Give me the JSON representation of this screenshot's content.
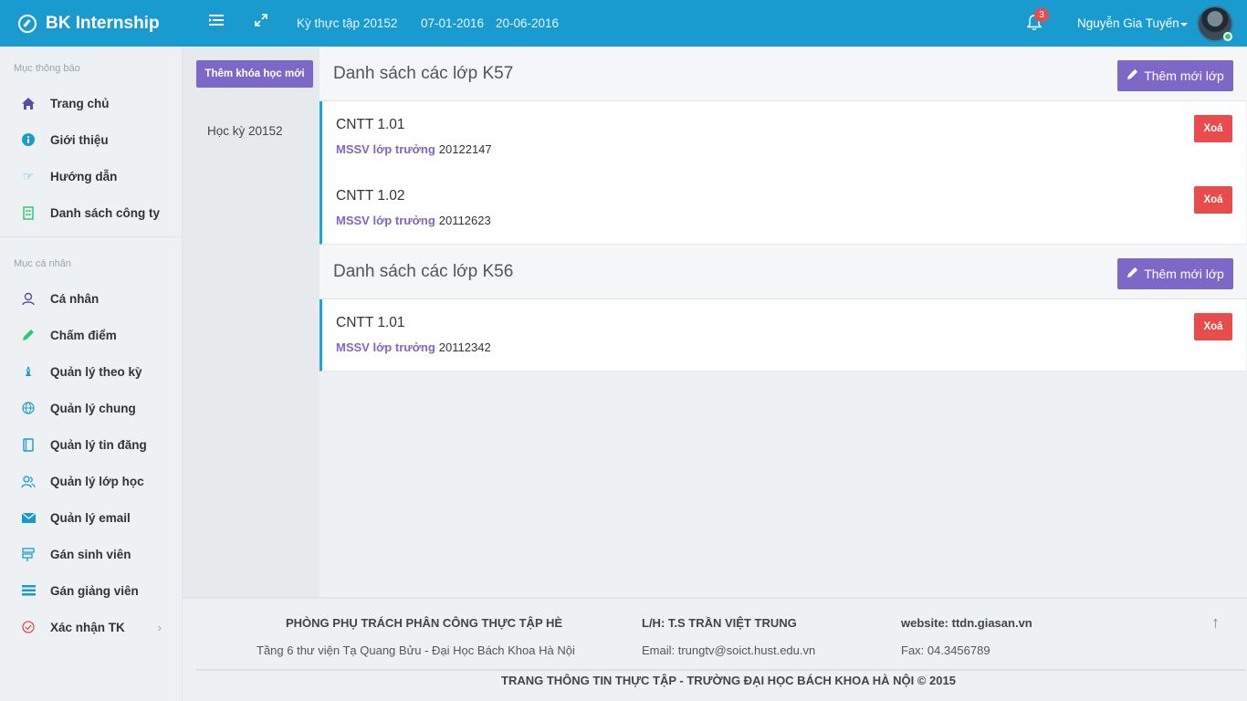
{
  "header": {
    "brand": "BK Internship",
    "term": "Kỳ thực tập 20152",
    "start_date": "07-01-2016",
    "end_date": "20-06-2016",
    "notification_count": "3",
    "user_name": "Nguyễn Gia Tuyến"
  },
  "sidebar": {
    "section1_title": "Mục thông báo",
    "section1_items": [
      {
        "label": "Trang chủ",
        "icon": "home-icon",
        "color": "#5b4aa8"
      },
      {
        "label": "Giới thiệu",
        "icon": "info-icon",
        "color": "#1a9bd0"
      },
      {
        "label": "Hướng dẫn",
        "icon": "hand-point-icon",
        "color": "#4fb7e0"
      },
      {
        "label": "Danh sách công ty",
        "icon": "building-icon",
        "color": "#2ecc71"
      }
    ],
    "section2_title": "Mục cá nhân",
    "section2_items": [
      {
        "label": "Cá nhân",
        "icon": "user-icon",
        "color": "#5b4aa8"
      },
      {
        "label": "Chấm điểm",
        "icon": "pencil-icon",
        "color": "#2ecc71"
      },
      {
        "label": "Quản lý theo kỳ",
        "icon": "chess-icon",
        "color": "#1a9bd0"
      },
      {
        "label": "Quản lý chung",
        "icon": "globe-icon",
        "color": "#1a9bd0"
      },
      {
        "label": "Quản lý tin đăng",
        "icon": "book-icon",
        "color": "#1a9bd0"
      },
      {
        "label": "Quản lý lớp học",
        "icon": "users-icon",
        "color": "#1a9bd0"
      },
      {
        "label": "Quản lý email",
        "icon": "envelope-icon",
        "color": "#1a9bd0"
      },
      {
        "label": "Gán sinh viên",
        "icon": "sign-icon",
        "color": "#1a9bd0"
      },
      {
        "label": "Gán giảng viên",
        "icon": "list-icon",
        "color": "#1a9bd0"
      },
      {
        "label": "Xác nhận TK",
        "icon": "check-circle-icon",
        "color": "#e84c4c"
      }
    ]
  },
  "courses": {
    "add_button": "Thêm khóa học mới",
    "items": [
      "Học kỳ 20152"
    ]
  },
  "sections": [
    {
      "title": "Danh sách các lớp K57",
      "add_button": "Thêm mới lớp",
      "classes": [
        {
          "name": "CNTT 1.01",
          "meta_key": "MSSV lớp trưởng",
          "meta_value": "20122147",
          "delete": "Xoá"
        },
        {
          "name": "CNTT 1.02",
          "meta_key": "MSSV lớp trưởng",
          "meta_value": "20112623",
          "delete": "Xoá"
        }
      ]
    },
    {
      "title": "Danh sách các lớp K56",
      "add_button": "Thêm mới lớp",
      "classes": [
        {
          "name": "CNTT 1.01",
          "meta_key": "MSSV lớp trưởng",
          "meta_value": "20112342",
          "delete": "Xoá"
        }
      ]
    }
  ],
  "footer": {
    "col1_title": "PHÒNG PHỤ TRÁCH PHÂN CÔNG THỰC TẬP HÈ",
    "col1_text": "Tầng 6 thư viện Tạ Quang Bửu - Đại Học Bách Khoa Hà Nội",
    "col2_title": "L/H: T.S TRẦN VIỆT TRUNG",
    "col2_text": "Email: trungtv@soict.hust.edu.vn",
    "col3_title": "website: ttdn.giasan.vn",
    "col3_text": "Fax: 04.3456789",
    "copyright": "TRANG THÔNG TIN THỰC TẬP - TRƯỜNG ĐẠI HỌC BÁCH KHOA HÀ NỘI © 2015"
  }
}
